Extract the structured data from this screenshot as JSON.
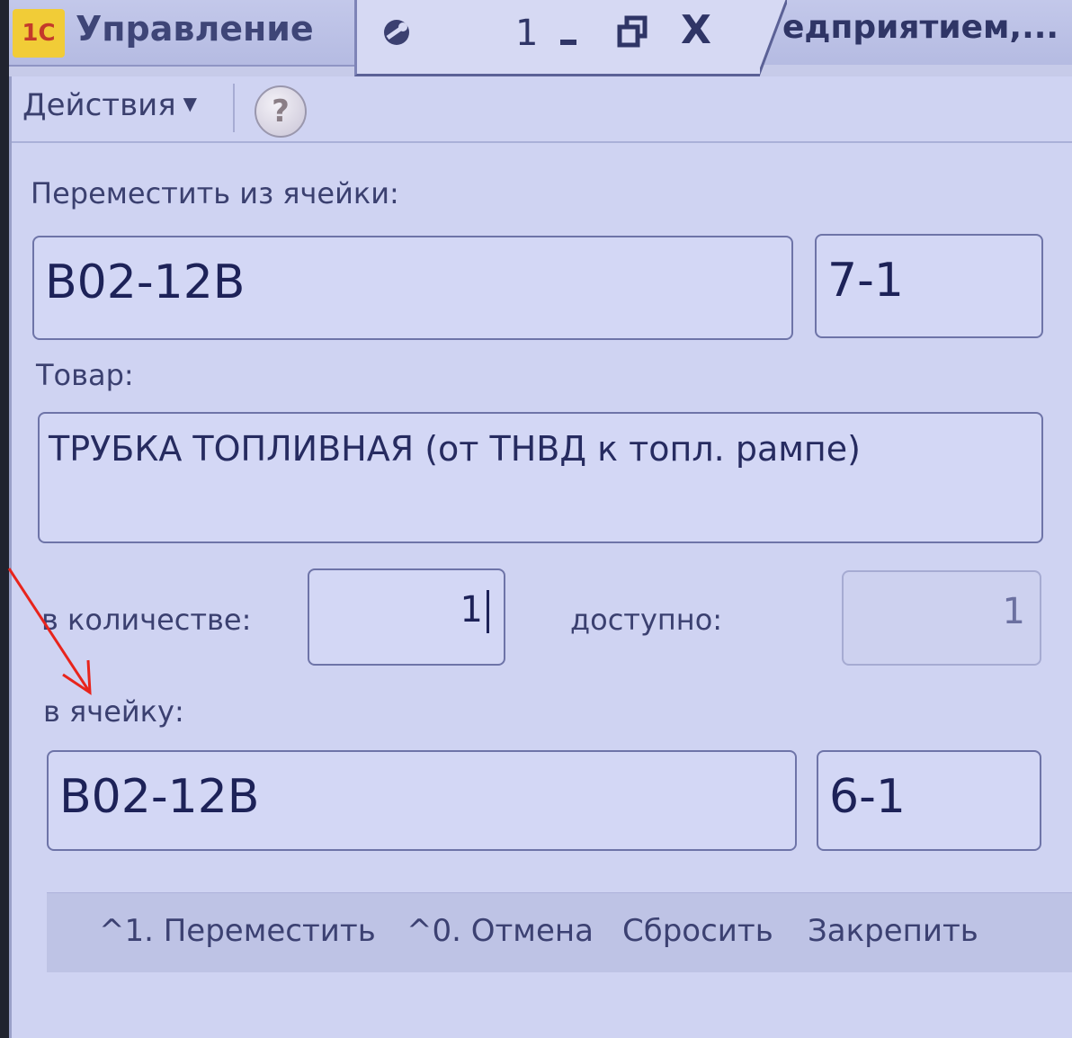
{
  "titlebar": {
    "logo_text": "1С",
    "app_title": "Управление",
    "window_number": "1",
    "close_glyph": "X",
    "right_tab_text": "едприятием,..."
  },
  "toolbar": {
    "actions_label": "Действия",
    "actions_caret": "▼",
    "help_glyph": "?"
  },
  "form": {
    "move_from_label": "Переместить из ячейки:",
    "from_cell": "B02-12B",
    "from_sub": "7-1",
    "product_label": "Товар:",
    "product_value": "ТРУБКА ТОПЛИВНАЯ (от ТНВД к топл. рампе)",
    "quantity_label": "в количестве:",
    "quantity_value": "1",
    "available_label": "доступно:",
    "available_value": "1",
    "to_cell_label": "в ячейку:",
    "to_cell": "B02-12B",
    "to_sub": "6-1"
  },
  "commands": {
    "move": "^1. Переместить",
    "cancel": "^0. Отмена",
    "reset": "Сбросить",
    "pin": "Закрепить"
  },
  "colors": {
    "background": "#cfd3f2",
    "accent_arrow": "#e8241c",
    "logo": "#f1cc37"
  },
  "icons": [
    "app-logo-icon",
    "window-icon",
    "minimize-icon",
    "restore-icon",
    "close-icon",
    "help-icon",
    "dropdown-caret-icon",
    "red-arrow-annotation"
  ]
}
